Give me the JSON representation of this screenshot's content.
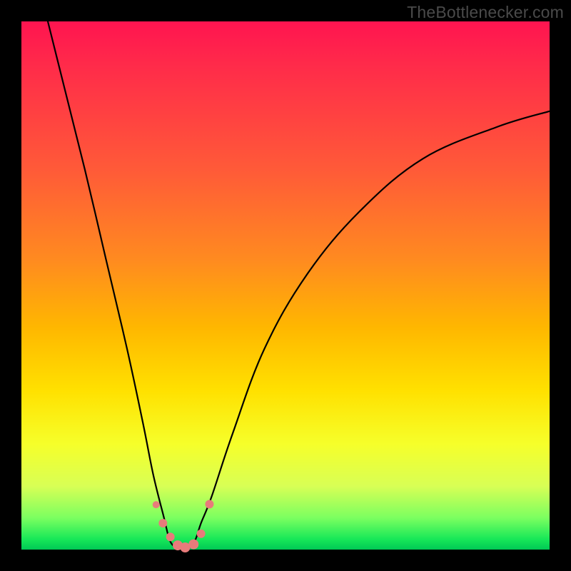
{
  "watermark": "TheBottlenecker.com",
  "chart_data": {
    "type": "line",
    "title": "",
    "xlabel": "",
    "ylabel": "",
    "xlim": [
      0,
      100
    ],
    "ylim": [
      0,
      100
    ],
    "description": "V-shaped bottleneck curve over a vertical red→green gradient. The curve drops steeply from the upper-left, reaches a flat minimum near x≈28–33 at the bottom (green zone), then rises with a shallower convex arc toward the upper right. A cluster of salmon-colored markers sits at the valley minimum.",
    "series": [
      {
        "name": "bottleneck-curve",
        "x": [
          5,
          8,
          12,
          16,
          20,
          23,
          25,
          27,
          28,
          29,
          30,
          31,
          32,
          33,
          34,
          36,
          40,
          46,
          54,
          64,
          76,
          90,
          100
        ],
        "y": [
          100,
          88,
          72,
          55,
          38,
          24,
          14,
          6,
          2,
          0.5,
          0,
          0,
          0.5,
          2,
          5,
          10,
          22,
          38,
          52,
          64,
          74,
          80,
          83
        ]
      }
    ],
    "markers": {
      "name": "valley-points",
      "color": "#e87b7b",
      "points": [
        {
          "x": 25.5,
          "y": 8.5,
          "r": 5
        },
        {
          "x": 26.8,
          "y": 5.0,
          "r": 6
        },
        {
          "x": 28.2,
          "y": 2.4,
          "r": 6
        },
        {
          "x": 29.6,
          "y": 0.8,
          "r": 7
        },
        {
          "x": 31.0,
          "y": 0.4,
          "r": 7
        },
        {
          "x": 32.6,
          "y": 1.0,
          "r": 7
        },
        {
          "x": 34.0,
          "y": 3.0,
          "r": 6
        },
        {
          "x": 35.6,
          "y": 8.6,
          "r": 6
        }
      ]
    },
    "gradient_stops": [
      {
        "pos": 0,
        "color": "#ff1450"
      },
      {
        "pos": 28,
        "color": "#ff5a38"
      },
      {
        "pos": 58,
        "color": "#ffb700"
      },
      {
        "pos": 80,
        "color": "#f6ff2a"
      },
      {
        "pos": 94,
        "color": "#7bff60"
      },
      {
        "pos": 100,
        "color": "#00c955"
      }
    ]
  }
}
